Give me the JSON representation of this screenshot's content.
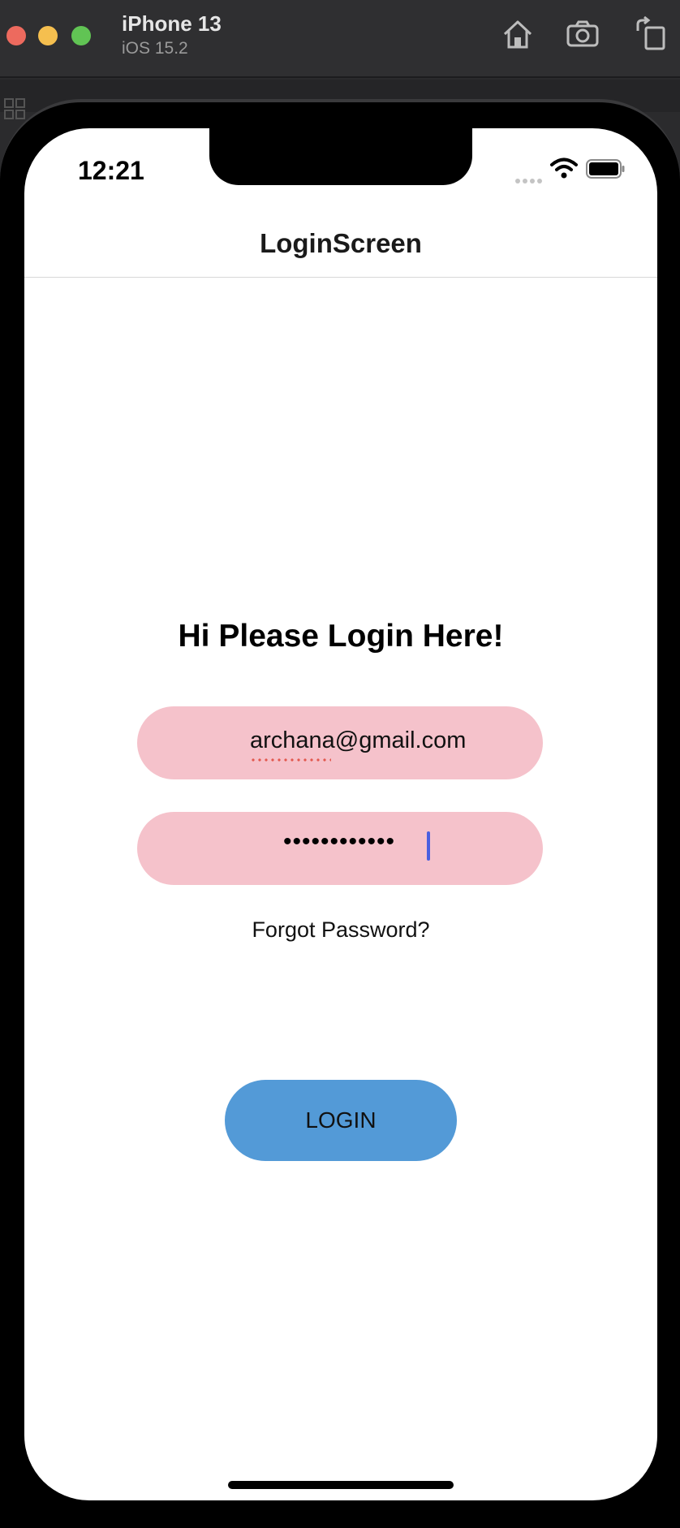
{
  "simulator": {
    "device_name": "iPhone 13",
    "os_version": "iOS 15.2",
    "icons": [
      "home-icon",
      "screenshot-icon",
      "rotate-icon"
    ]
  },
  "status_bar": {
    "time": "12:21",
    "icons": [
      "signal-dots-icon",
      "wifi-icon",
      "battery-icon"
    ]
  },
  "nav": {
    "title": "LoginScreen"
  },
  "login": {
    "heading": "Hi Please Login Here!",
    "email_value": "archana@gmail.com",
    "password_value": "••••••••••••",
    "forgot_label": "Forgot Password?",
    "login_label": "LOGIN"
  },
  "colors": {
    "field_bg": "#f5c2cb",
    "button_bg": "#539ad7",
    "caret": "#4a5fe0"
  }
}
